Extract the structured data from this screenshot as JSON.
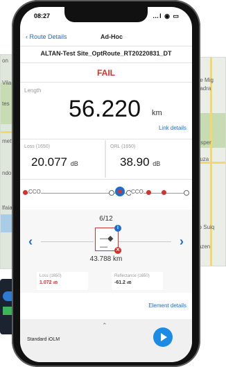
{
  "colors": {
    "accent": "#1c6dd0",
    "fail": "#d0342c",
    "link": "#1c6dd0"
  },
  "status_bar": {
    "time": "08:27",
    "icons": "…l ◉ ▭"
  },
  "nav": {
    "back_label": "‹ Route Details",
    "title": "Ad-Hoc"
  },
  "route_name": "ALTAN-Test Site_OptRoute_RT20220831_DT",
  "result": "FAIL",
  "length": {
    "label": "Length",
    "value": "56.220",
    "unit": "km",
    "link_label": "Link details"
  },
  "loss": {
    "label": "Loss  (1650)",
    "value": "20.077",
    "unit": "dB"
  },
  "orl": {
    "label": "ORL  (1650)",
    "value": "38.90",
    "unit": "dB"
  },
  "trace": {
    "left_label": "CCO",
    "mid_label": "CCO"
  },
  "element": {
    "counter": "6/12",
    "distance": "43.788 km",
    "loss_label": "Loss (1650)",
    "loss_value": "1.072",
    "loss_unit": "dB",
    "refl_label": "Reflectance (1650)",
    "refl_value": "-61.2",
    "refl_unit": "dB",
    "details_label": "Element details"
  },
  "bottom": {
    "mode": "Standard iOLM"
  },
  "maps": {
    "left": [
      "on",
      "Vila",
      "tes",
      "mett",
      "ndo",
      "lfaia"
    ],
    "right": [
      "R",
      "dade Mig",
      "Badra",
      "m Esper",
      "Suza",
      "Sítio Suiq",
      "Fazen"
    ]
  }
}
